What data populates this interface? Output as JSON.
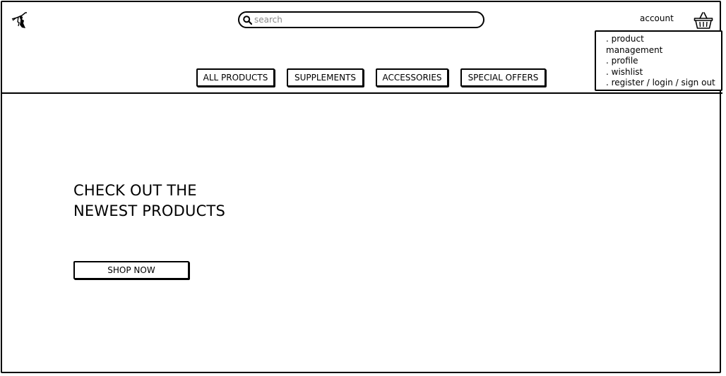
{
  "header": {
    "logo_icon": "wizard-logo-icon",
    "search": {
      "placeholder": "search",
      "icon": "search-icon"
    },
    "account_label": "account",
    "basket_icon": "basket-icon"
  },
  "account_menu": {
    "items": [
      {
        "label": ". product"
      },
      {
        "label": "management"
      },
      {
        "label": ". profile"
      },
      {
        "label": ". wishlist"
      },
      {
        "label": ". register / login / sign out"
      }
    ]
  },
  "nav": {
    "items": [
      {
        "label": "ALL PRODUCTS"
      },
      {
        "label": "SUPPLEMENTS"
      },
      {
        "label": "ACCESSORIES"
      },
      {
        "label": "SPECIAL OFFERS"
      }
    ]
  },
  "hero": {
    "heading_line1": "CHECK OUT THE",
    "heading_line2": "NEWEST PRODUCTS",
    "cta_label": "SHOP NOW"
  }
}
